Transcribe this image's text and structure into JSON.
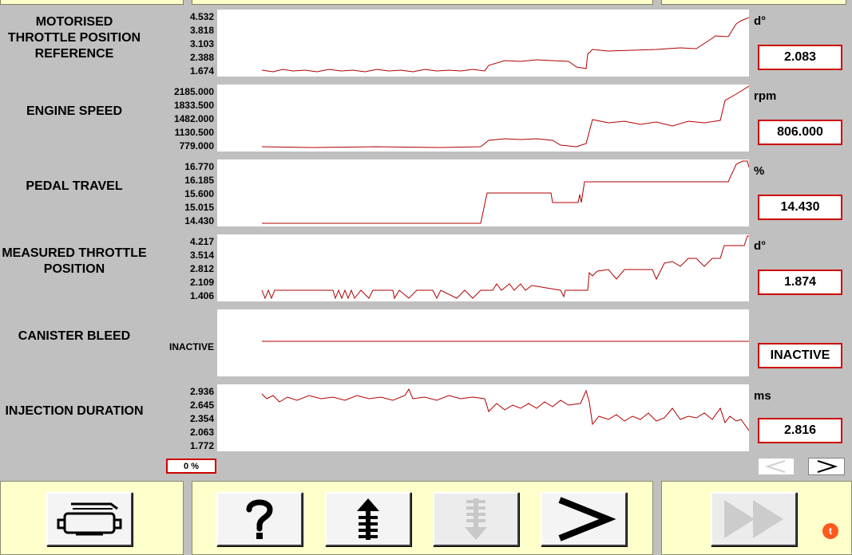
{
  "parameters": [
    {
      "label_lines": [
        "MOTORISED",
        "THROTTLE POSITION",
        "REFERENCE"
      ],
      "ticks": [
        "4.532",
        "3.818",
        "3.103",
        "2.388",
        "1.674"
      ],
      "unit": "d°",
      "value": "2.083"
    },
    {
      "label_lines": [
        "ENGINE SPEED"
      ],
      "ticks": [
        "2185.000",
        "1833.500",
        "1482.000",
        "1130.500",
        "779.000"
      ],
      "unit": "rpm",
      "value": "806.000"
    },
    {
      "label_lines": [
        "PEDAL TRAVEL"
      ],
      "ticks": [
        "16.770",
        "16.185",
        "15.600",
        "15.015",
        "14.430"
      ],
      "unit": "%",
      "value": "14.430"
    },
    {
      "label_lines": [
        "MEASURED THROTTLE",
        "POSITION"
      ],
      "ticks": [
        "4.217",
        "3.514",
        "2.812",
        "2.109",
        "1.406"
      ],
      "unit": "d°",
      "value": "1.874"
    },
    {
      "label_lines": [
        "CANISTER BLEED"
      ],
      "ticks": [
        "INACTIVE"
      ],
      "unit": "",
      "value": "INACTIVE"
    },
    {
      "label_lines": [
        "INJECTION DURATION"
      ],
      "ticks": [
        "2.936",
        "2.645",
        "2.354",
        "2.063",
        "1.772"
      ],
      "unit": "ms",
      "value": "2.816"
    }
  ],
  "progress": {
    "label": "0 %"
  },
  "scroll": {
    "prev_icon": "chevron-left-icon",
    "next_icon": "chevron-right-icon"
  },
  "toolbar": {
    "print_icon": "printer-icon",
    "help_icon": "question-mark-icon",
    "up_icon": "arrow-up-icon",
    "down_icon": "arrow-down-icon",
    "next_icon": "chevron-right-icon",
    "fast_forward_icon": "fast-forward-icon"
  },
  "badge": {
    "label": "t"
  },
  "colors": {
    "trace": "#b00000",
    "value_border": "#cc0000",
    "panel": "#ffffcc"
  }
}
